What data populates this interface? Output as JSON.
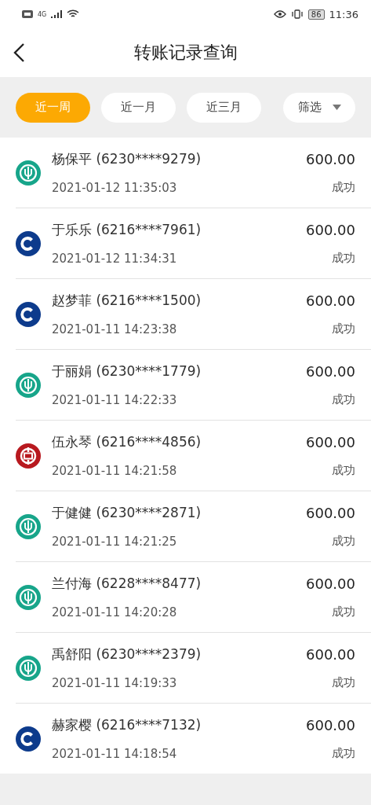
{
  "status_bar": {
    "network": "4G",
    "battery": "86",
    "time": "11:36"
  },
  "header": {
    "title": "转账记录查询"
  },
  "filters": [
    {
      "label": "近一周",
      "selected": true
    },
    {
      "label": "近一月",
      "selected": false
    },
    {
      "label": "近三月",
      "selected": false
    }
  ],
  "filter_menu": {
    "label": "筛选"
  },
  "records": [
    {
      "kind": "wheat",
      "name": "杨保平 (6230****9279)",
      "time": "2021-01-12 11:35:03",
      "amount": "600.00",
      "status": "成功"
    },
    {
      "kind": "coin-c",
      "name": "于乐乐 (6216****7961)",
      "time": "2021-01-12 11:34:31",
      "amount": "600.00",
      "status": "成功"
    },
    {
      "kind": "coin-c",
      "name": "赵梦菲 (6216****1500)",
      "time": "2021-01-11 14:23:38",
      "amount": "600.00",
      "status": "成功"
    },
    {
      "kind": "wheat",
      "name": "于丽娟 (6230****1779)",
      "time": "2021-01-11 14:22:33",
      "amount": "600.00",
      "status": "成功"
    },
    {
      "kind": "coin-square",
      "name": "伍永琴 (6216****4856)",
      "time": "2021-01-11 14:21:58",
      "amount": "600.00",
      "status": "成功"
    },
    {
      "kind": "wheat",
      "name": "于健健 (6230****2871)",
      "time": "2021-01-11 14:21:25",
      "amount": "600.00",
      "status": "成功"
    },
    {
      "kind": "wheat",
      "name": "兰付海 (6228****8477)",
      "time": "2021-01-11 14:20:28",
      "amount": "600.00",
      "status": "成功"
    },
    {
      "kind": "wheat",
      "name": "禹舒阳 (6230****2379)",
      "time": "2021-01-11 14:19:33",
      "amount": "600.00",
      "status": "成功"
    },
    {
      "kind": "coin-c",
      "name": "赫家樱 (6216****7132)",
      "time": "2021-01-11 14:18:54",
      "amount": "600.00",
      "status": "成功"
    }
  ]
}
